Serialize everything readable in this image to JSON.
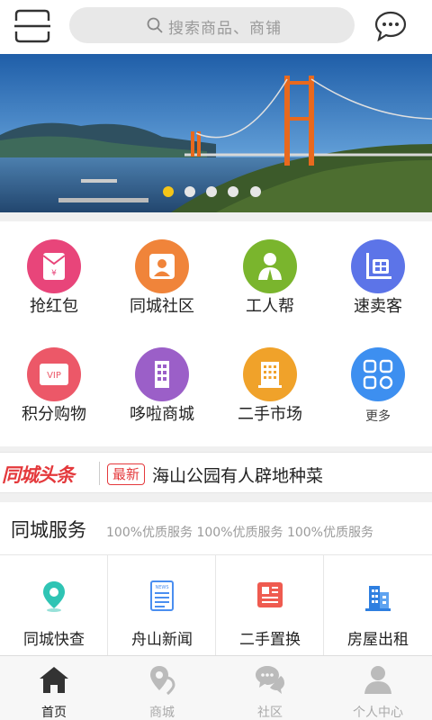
{
  "header": {
    "search_placeholder": "搜索商品、商铺"
  },
  "banner": {
    "slide_count": 5,
    "active_slide": 1,
    "active_color": "#f5c518"
  },
  "grid": [
    {
      "label": "抢红包",
      "icon": "red-envelope-icon",
      "color": "#e8457a"
    },
    {
      "label": "同城社区",
      "icon": "person-icon",
      "color": "#f0843a"
    },
    {
      "label": "工人帮",
      "icon": "worker-icon",
      "color": "#7ab52d"
    },
    {
      "label": "速卖客",
      "icon": "cart-icon",
      "color": "#5c74e8"
    },
    {
      "label": "积分购物",
      "icon": "vip-icon",
      "color": "#ec5868"
    },
    {
      "label": "哆啦商城",
      "icon": "store-icon",
      "color": "#9b5fc8"
    },
    {
      "label": "二手市场",
      "icon": "building-icon",
      "color": "#f0a22a"
    },
    {
      "label": "更多",
      "icon": "grid-more-icon",
      "color": "#3d8ff0"
    }
  ],
  "headline": {
    "logo": "同城头条",
    "badge": "最新",
    "text": "海山公园有人辟地种菜"
  },
  "services": {
    "title": "同城服务",
    "subtitle": "100%优质服务 100%优质服务 100%优质服务",
    "items": [
      {
        "label": "同城快查",
        "icon": "location-pin-icon",
        "color": "#2fc4b4"
      },
      {
        "label": "舟山新闻",
        "icon": "news-icon",
        "color": "#4a8ef0"
      },
      {
        "label": "二手置换",
        "icon": "exchange-icon",
        "color": "#ef5b50"
      },
      {
        "label": "房屋出租",
        "icon": "house-rent-icon",
        "color": "#2e7fe0"
      }
    ]
  },
  "tabs": [
    {
      "label": "首页",
      "icon": "home-icon",
      "active": true
    },
    {
      "label": "商城",
      "icon": "mall-pin-icon",
      "active": false
    },
    {
      "label": "社区",
      "icon": "chat-bubbles-icon",
      "active": false
    },
    {
      "label": "个人中心",
      "icon": "user-icon",
      "active": false
    }
  ]
}
